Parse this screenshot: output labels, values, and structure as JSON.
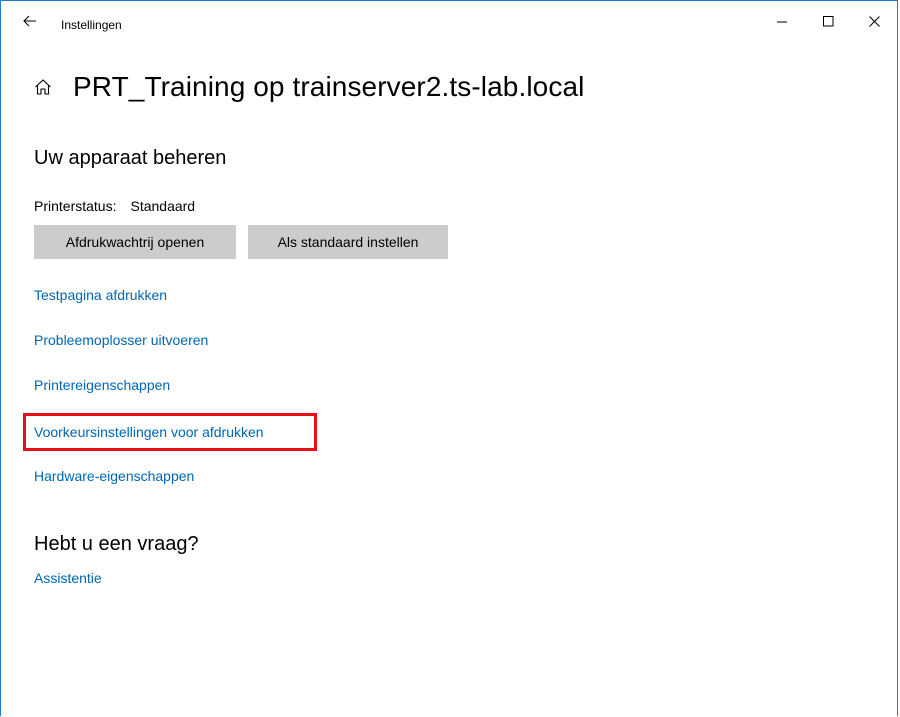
{
  "window": {
    "title": "Instellingen"
  },
  "icons": {
    "back": "back-arrow-icon",
    "minimize": "minimize-icon",
    "maximize": "maximize-icon",
    "close": "close-icon",
    "home": "home-icon"
  },
  "page": {
    "title": "PRT_Training op trainserver2.ts-lab.local"
  },
  "manage": {
    "heading": "Uw apparaat beheren",
    "status_label": "Printerstatus:",
    "status_value": "Standaard",
    "buttons": {
      "open_queue": "Afdrukwachtrij openen",
      "set_default": "Als standaard instellen"
    },
    "links": {
      "test_page": "Testpagina afdrukken",
      "troubleshooter": "Probleemoplosser uitvoeren",
      "printer_properties": "Printereigenschappen",
      "printing_preferences": "Voorkeursinstellingen voor afdrukken",
      "hardware_properties": "Hardware-eigenschappen"
    }
  },
  "help": {
    "heading": "Hebt u een vraag?",
    "link": "Assistentie"
  },
  "colors": {
    "link": "#0066b4",
    "button_bg": "#cccccc",
    "highlight": "#e8101a",
    "window_border": "#1e78d6"
  }
}
